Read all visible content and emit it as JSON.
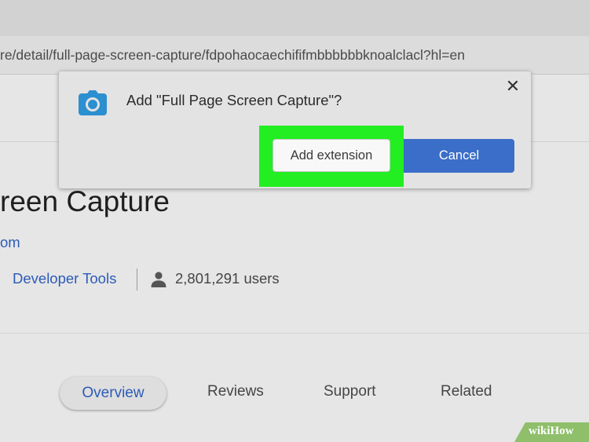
{
  "browser": {
    "url": "re/detail/full-page-screen-capture/fdpohaocaechififmbbbbbbknoalclacl?hl=en"
  },
  "extension": {
    "title_partial": "reen Capture",
    "site_partial": "om",
    "category": "Developer Tools",
    "users": "2,801,291 users"
  },
  "tabs": [
    {
      "label": "Overview",
      "active": true
    },
    {
      "label": "Reviews",
      "active": false
    },
    {
      "label": "Support",
      "active": false
    },
    {
      "label": "Related",
      "active": false
    }
  ],
  "dialog": {
    "message": "Add \"Full Page Screen Capture\"?",
    "add_label": "Add extension",
    "cancel_label": "Cancel",
    "close_glyph": "✕",
    "icon": "camera-icon",
    "icon_color": "#2c8fcf"
  },
  "colors": {
    "highlight": "#22ee22",
    "link": "#2c5bb8",
    "primary_button": "#3a6ec8"
  },
  "watermark": {
    "prefix": "wiki",
    "suffix": "How"
  }
}
